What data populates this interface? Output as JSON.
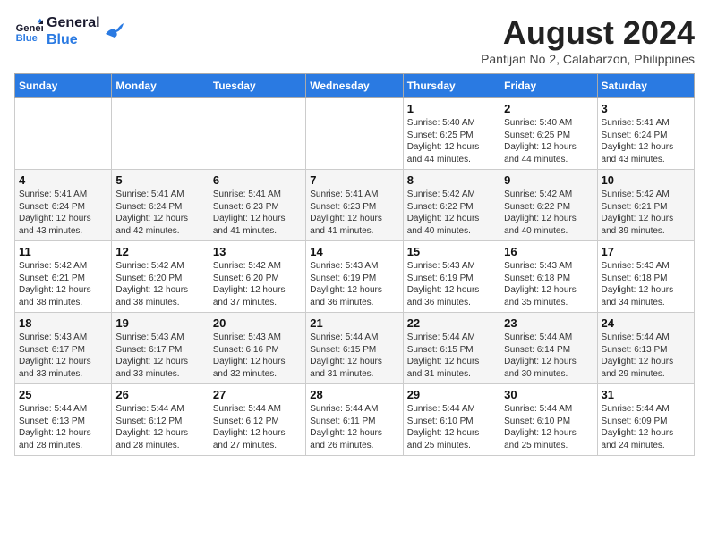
{
  "logo": {
    "line1": "General",
    "line2": "Blue"
  },
  "title": "August 2024",
  "subtitle": "Pantijan No 2, Calabarzon, Philippines",
  "weekdays": [
    "Sunday",
    "Monday",
    "Tuesday",
    "Wednesday",
    "Thursday",
    "Friday",
    "Saturday"
  ],
  "weeks": [
    [
      {
        "day": "",
        "info": ""
      },
      {
        "day": "",
        "info": ""
      },
      {
        "day": "",
        "info": ""
      },
      {
        "day": "",
        "info": ""
      },
      {
        "day": "1",
        "info": "Sunrise: 5:40 AM\nSunset: 6:25 PM\nDaylight: 12 hours\nand 44 minutes."
      },
      {
        "day": "2",
        "info": "Sunrise: 5:40 AM\nSunset: 6:25 PM\nDaylight: 12 hours\nand 44 minutes."
      },
      {
        "day": "3",
        "info": "Sunrise: 5:41 AM\nSunset: 6:24 PM\nDaylight: 12 hours\nand 43 minutes."
      }
    ],
    [
      {
        "day": "4",
        "info": "Sunrise: 5:41 AM\nSunset: 6:24 PM\nDaylight: 12 hours\nand 43 minutes."
      },
      {
        "day": "5",
        "info": "Sunrise: 5:41 AM\nSunset: 6:24 PM\nDaylight: 12 hours\nand 42 minutes."
      },
      {
        "day": "6",
        "info": "Sunrise: 5:41 AM\nSunset: 6:23 PM\nDaylight: 12 hours\nand 41 minutes."
      },
      {
        "day": "7",
        "info": "Sunrise: 5:41 AM\nSunset: 6:23 PM\nDaylight: 12 hours\nand 41 minutes."
      },
      {
        "day": "8",
        "info": "Sunrise: 5:42 AM\nSunset: 6:22 PM\nDaylight: 12 hours\nand 40 minutes."
      },
      {
        "day": "9",
        "info": "Sunrise: 5:42 AM\nSunset: 6:22 PM\nDaylight: 12 hours\nand 40 minutes."
      },
      {
        "day": "10",
        "info": "Sunrise: 5:42 AM\nSunset: 6:21 PM\nDaylight: 12 hours\nand 39 minutes."
      }
    ],
    [
      {
        "day": "11",
        "info": "Sunrise: 5:42 AM\nSunset: 6:21 PM\nDaylight: 12 hours\nand 38 minutes."
      },
      {
        "day": "12",
        "info": "Sunrise: 5:42 AM\nSunset: 6:20 PM\nDaylight: 12 hours\nand 38 minutes."
      },
      {
        "day": "13",
        "info": "Sunrise: 5:42 AM\nSunset: 6:20 PM\nDaylight: 12 hours\nand 37 minutes."
      },
      {
        "day": "14",
        "info": "Sunrise: 5:43 AM\nSunset: 6:19 PM\nDaylight: 12 hours\nand 36 minutes."
      },
      {
        "day": "15",
        "info": "Sunrise: 5:43 AM\nSunset: 6:19 PM\nDaylight: 12 hours\nand 36 minutes."
      },
      {
        "day": "16",
        "info": "Sunrise: 5:43 AM\nSunset: 6:18 PM\nDaylight: 12 hours\nand 35 minutes."
      },
      {
        "day": "17",
        "info": "Sunrise: 5:43 AM\nSunset: 6:18 PM\nDaylight: 12 hours\nand 34 minutes."
      }
    ],
    [
      {
        "day": "18",
        "info": "Sunrise: 5:43 AM\nSunset: 6:17 PM\nDaylight: 12 hours\nand 33 minutes."
      },
      {
        "day": "19",
        "info": "Sunrise: 5:43 AM\nSunset: 6:17 PM\nDaylight: 12 hours\nand 33 minutes."
      },
      {
        "day": "20",
        "info": "Sunrise: 5:43 AM\nSunset: 6:16 PM\nDaylight: 12 hours\nand 32 minutes."
      },
      {
        "day": "21",
        "info": "Sunrise: 5:44 AM\nSunset: 6:15 PM\nDaylight: 12 hours\nand 31 minutes."
      },
      {
        "day": "22",
        "info": "Sunrise: 5:44 AM\nSunset: 6:15 PM\nDaylight: 12 hours\nand 31 minutes."
      },
      {
        "day": "23",
        "info": "Sunrise: 5:44 AM\nSunset: 6:14 PM\nDaylight: 12 hours\nand 30 minutes."
      },
      {
        "day": "24",
        "info": "Sunrise: 5:44 AM\nSunset: 6:13 PM\nDaylight: 12 hours\nand 29 minutes."
      }
    ],
    [
      {
        "day": "25",
        "info": "Sunrise: 5:44 AM\nSunset: 6:13 PM\nDaylight: 12 hours\nand 28 minutes."
      },
      {
        "day": "26",
        "info": "Sunrise: 5:44 AM\nSunset: 6:12 PM\nDaylight: 12 hours\nand 28 minutes."
      },
      {
        "day": "27",
        "info": "Sunrise: 5:44 AM\nSunset: 6:12 PM\nDaylight: 12 hours\nand 27 minutes."
      },
      {
        "day": "28",
        "info": "Sunrise: 5:44 AM\nSunset: 6:11 PM\nDaylight: 12 hours\nand 26 minutes."
      },
      {
        "day": "29",
        "info": "Sunrise: 5:44 AM\nSunset: 6:10 PM\nDaylight: 12 hours\nand 25 minutes."
      },
      {
        "day": "30",
        "info": "Sunrise: 5:44 AM\nSunset: 6:10 PM\nDaylight: 12 hours\nand 25 minutes."
      },
      {
        "day": "31",
        "info": "Sunrise: 5:44 AM\nSunset: 6:09 PM\nDaylight: 12 hours\nand 24 minutes."
      }
    ]
  ]
}
